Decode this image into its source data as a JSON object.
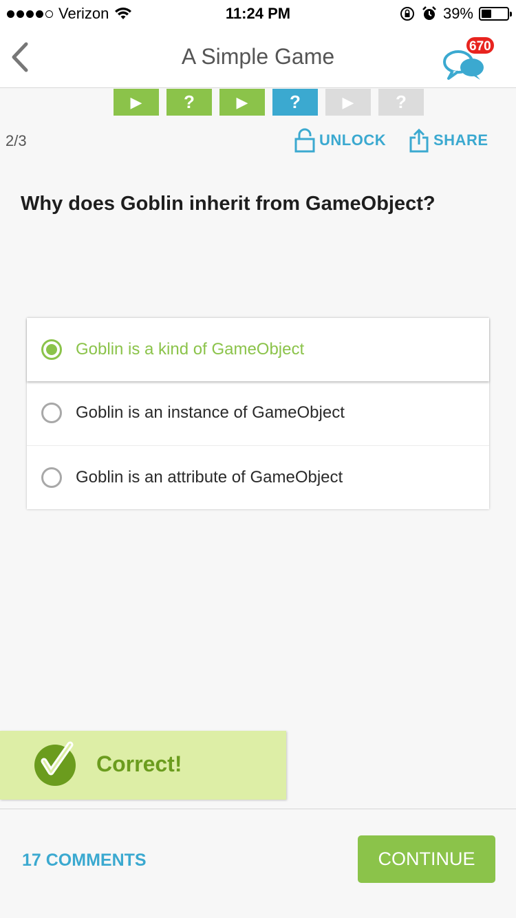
{
  "status_bar": {
    "carrier": "Verizon",
    "time": "11:24 PM",
    "battery": "39%",
    "battery_level": 0.39,
    "signal_bars_filled": 4,
    "signal_bars_total": 5
  },
  "nav": {
    "title": "A Simple Game",
    "chat_badge": "670"
  },
  "progress": {
    "tiles": [
      {
        "type": "play",
        "state": "done",
        "glyph": "▶"
      },
      {
        "type": "question",
        "state": "done",
        "glyph": "?"
      },
      {
        "type": "play",
        "state": "done",
        "glyph": "▶"
      },
      {
        "type": "question",
        "state": "current",
        "glyph": "?"
      },
      {
        "type": "play",
        "state": "locked",
        "glyph": "▶"
      },
      {
        "type": "question",
        "state": "locked",
        "glyph": "?"
      }
    ]
  },
  "toolbar": {
    "page_counter": "2/3",
    "unlock_label": "UNLOCK",
    "share_label": "SHARE"
  },
  "question": {
    "text": "Why does Goblin inherit from GameObject?",
    "options": [
      {
        "label": "Goblin is a kind of GameObject",
        "selected": true
      },
      {
        "label": "Goblin is an instance of GameObject",
        "selected": false
      },
      {
        "label": "Goblin is an attribute of GameObject",
        "selected": false
      }
    ]
  },
  "feedback": {
    "text": "Correct!"
  },
  "footer": {
    "comments_label": "17 COMMENTS",
    "continue_label": "CONTINUE"
  },
  "colors": {
    "accent_green": "#8bc34a",
    "accent_blue": "#3ba9d0",
    "feedback_bg": "#ddeea6",
    "badge_red": "#e8241f"
  }
}
